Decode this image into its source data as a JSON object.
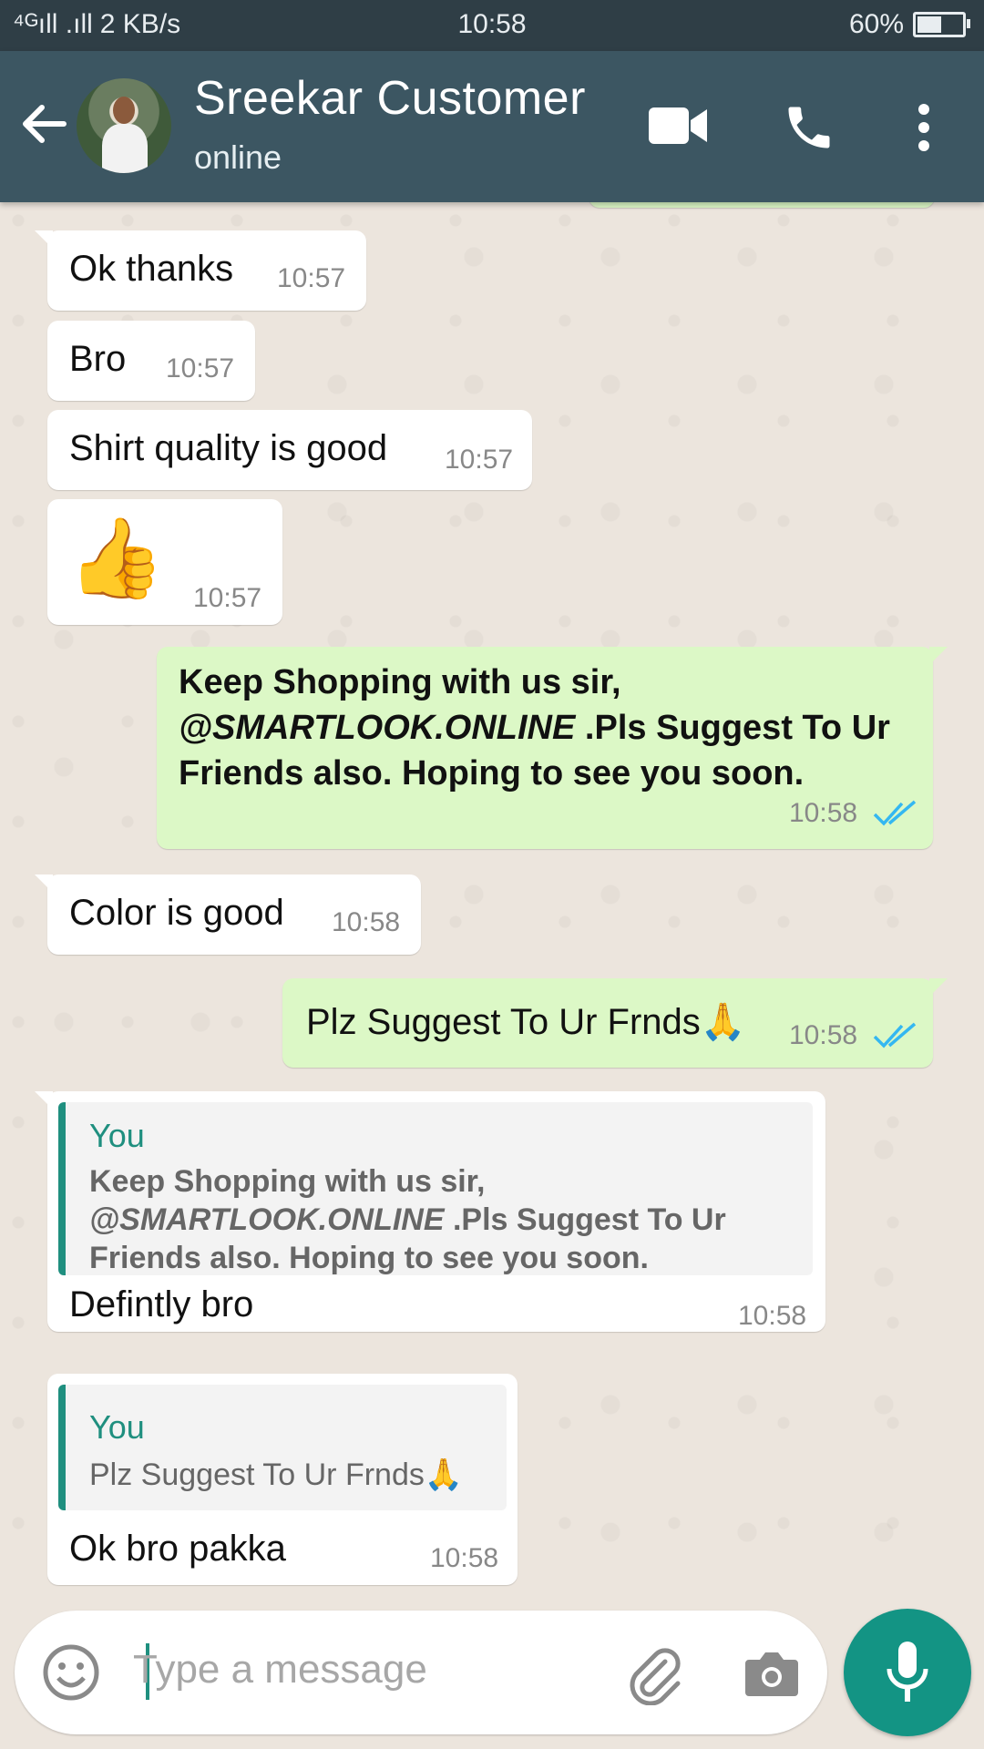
{
  "status_bar": {
    "signal": "⁴ᴳıll .ıll",
    "speed": "2 KB/s",
    "time": "10:58",
    "battery": "60%",
    "battery_level": 0.6
  },
  "header": {
    "name": "Sreekar Customer",
    "status": "online",
    "icons": [
      "back-arrow-icon",
      "video-call-icon",
      "phone-icon",
      "more-vert-icon"
    ]
  },
  "messages": [
    {
      "text": "Ok thanks",
      "time": "10:57"
    },
    {
      "text": "Bro",
      "time": "10:57"
    },
    {
      "text": "Shirt quality is good",
      "time": "10:57"
    },
    {
      "emoji": "👍",
      "time": "10:57"
    },
    {
      "line1": "Keep Shopping with us sir,",
      "line2_italic": "@SMARTLOOK.ONLINE",
      "line2_rest": " .Pls Suggest To Ur",
      "line3": "Friends also. Hoping to see you soon.",
      "time": "10:58"
    },
    {
      "text": "Color is good",
      "time": "10:58"
    },
    {
      "text": "Plz Suggest To Ur Frnds🙏",
      "time": "10:58"
    },
    {
      "quote_name": "You",
      "quote_line1": "Keep Shopping with us sir,",
      "quote_line2_italic": "@SMARTLOOK.ONLINE",
      "quote_line2_rest": " .Pls Suggest To Ur",
      "quote_line3": "Friends also. Hoping to see you soon.",
      "text": "Defintly bro",
      "time": "10:58"
    },
    {
      "quote_name": "You",
      "quote_text": "Plz Suggest To Ur Frnds🙏",
      "text": "Ok bro pakka",
      "time": "10:58"
    }
  ],
  "input": {
    "placeholder": "Type a message",
    "icons": [
      "emoji-icon",
      "attach-icon",
      "camera-icon",
      "mic-icon"
    ]
  },
  "colors": {
    "header": "#3c5662",
    "status_bar": "#2f3e46",
    "outgoing_bubble": "#dcf8c6",
    "incoming_bubble": "#ffffff",
    "accent": "#139484",
    "read_ticks": "#34b7f1"
  }
}
